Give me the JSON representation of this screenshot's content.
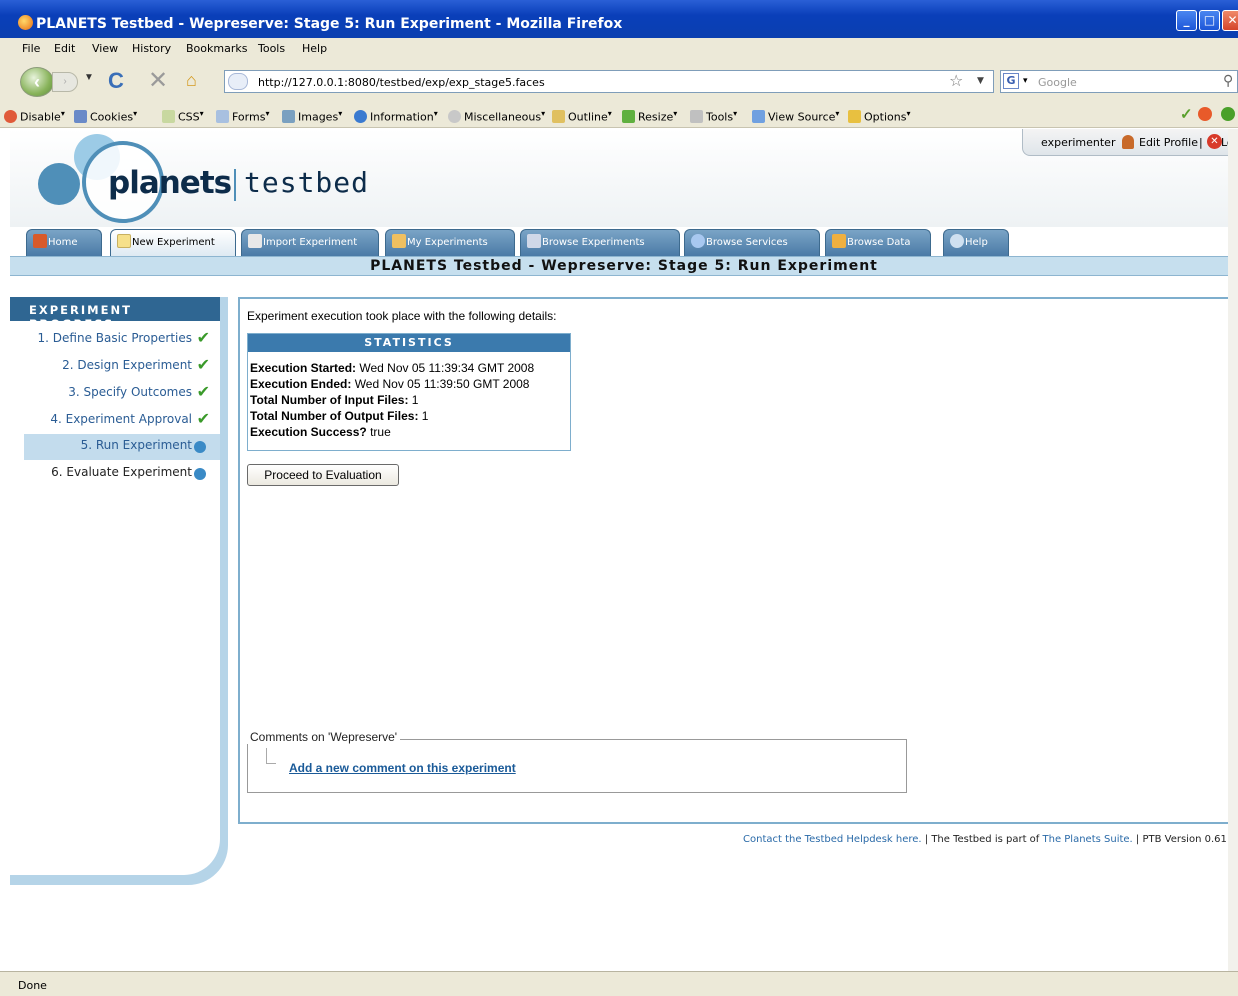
{
  "window": {
    "title": "PLANETS Testbed - Wepreserve: Stage 5: Run Experiment - Mozilla Firefox",
    "icon": "firefox-icon"
  },
  "menubar": [
    "File",
    "Edit",
    "View",
    "History",
    "Bookmarks",
    "Tools",
    "Help"
  ],
  "navigation": {
    "url": "http://127.0.0.1:8080/testbed/exp/exp_stage5.faces",
    "search_placeholder": "Google"
  },
  "devtoolbar": [
    "Disable",
    "Cookies",
    "CSS",
    "Forms",
    "Images",
    "Information",
    "Miscellaneous",
    "Outline",
    "Resize",
    "Tools",
    "View Source",
    "Options"
  ],
  "header": {
    "logo_text": "planets",
    "logo_sub": "testbed",
    "user": "experimenter",
    "edit_profile": "Edit Profile",
    "separator": "|",
    "logout": "Logo"
  },
  "tabs": [
    {
      "label": "Home",
      "icon": "home-icon",
      "color": "#d85a2a"
    },
    {
      "label": "New Experiment",
      "icon": "new-document-icon",
      "color": "#f6e08a"
    },
    {
      "label": "Import Experiment",
      "icon": "import-icon",
      "color": "#e8e8e8"
    },
    {
      "label": "My Experiments",
      "icon": "my-experiments-icon",
      "color": "#f0c060"
    },
    {
      "label": "Browse Experiments",
      "icon": "browse-experiments-icon",
      "color": "#d0d8e8"
    },
    {
      "label": "Browse Services",
      "icon": "browse-services-icon",
      "color": "#a8c8f0"
    },
    {
      "label": "Browse Data",
      "icon": "browse-data-icon",
      "color": "#f0b040"
    },
    {
      "label": "Help",
      "icon": "help-icon",
      "color": "#cfe0f0"
    }
  ],
  "page_title": "PLANETS Testbed - Wepreserve: Stage 5: Run Experiment",
  "sidebar": {
    "heading": "EXPERIMENT PROGRESS",
    "steps": [
      {
        "label": "1. Define Basic Properties",
        "status": "done"
      },
      {
        "label": "2. Design Experiment",
        "status": "done"
      },
      {
        "label": "3. Specify Outcomes",
        "status": "done"
      },
      {
        "label": "4. Experiment Approval",
        "status": "done"
      },
      {
        "label": "5. Run Experiment",
        "status": "current"
      },
      {
        "label": "6. Evaluate Experiment",
        "status": "pending"
      }
    ]
  },
  "main": {
    "intro": "Experiment execution took place with the following details:",
    "statistics": {
      "heading": "STATISTICS",
      "rows": [
        {
          "label": "Execution Started:",
          "value": "Wed Nov 05 11:39:34 GMT 2008"
        },
        {
          "label": "Execution Ended:",
          "value": "Wed Nov 05 11:39:50 GMT 2008"
        },
        {
          "label": "Total Number of Input Files:",
          "value": "1"
        },
        {
          "label": "Total Number of Output Files:",
          "value": "1"
        },
        {
          "label": "Execution Success?",
          "value": "true"
        }
      ]
    },
    "proceed_button": "Proceed to Evaluation",
    "comments": {
      "legend": "Comments on 'Wepreserve'",
      "add_link": "Add a new comment on this experiment"
    }
  },
  "footer": {
    "helpdesk_link": "Contact the Testbed Helpdesk here.",
    "middle_text": " | The Testbed is part of ",
    "suite_link": "The Planets Suite.",
    "version": " | PTB Version 0.61"
  },
  "statusbar": "Done",
  "colors": {
    "accent": "#2f6692",
    "link": "#1a5a98",
    "strip": "#c6dfee",
    "done_check": "#3a9a2a",
    "dot": "#3a8ac6"
  }
}
